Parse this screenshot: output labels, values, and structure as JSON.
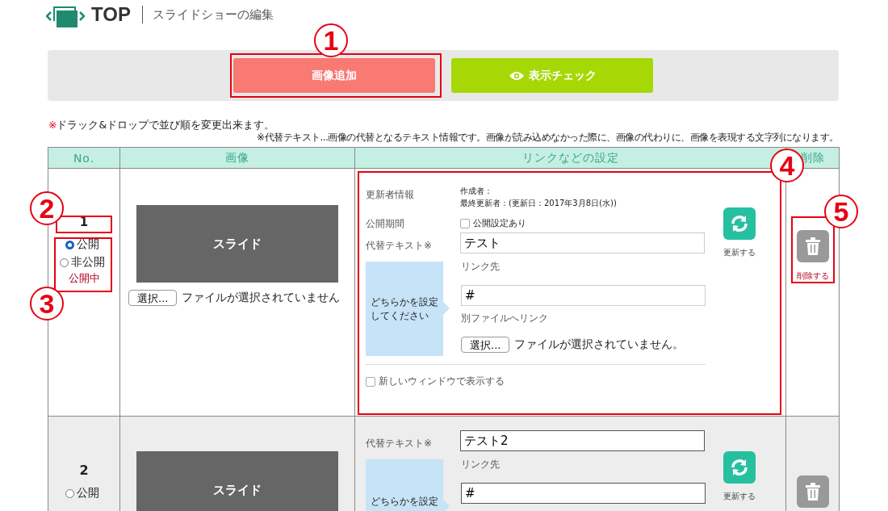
{
  "header": {
    "logo_text": "TOP",
    "subtitle": "スライドショーの編集"
  },
  "toolbar": {
    "add_button": "画像追加",
    "preview_button": "表示チェック"
  },
  "notes": {
    "mark": "※",
    "drag_note": "ドラック&ドロップで並び順を変更出来ます。",
    "alt_note": "※代替テキスト...画像の代替となるテキスト情報です。画像が読み込めなかった際に、画像の代わりに、画像を表現する文字列になります。"
  },
  "table": {
    "columns": [
      "No.",
      "画像",
      "リンクなどの設定",
      "削除"
    ],
    "rows": [
      {
        "no": "1",
        "visibility": [
          {
            "label": "公開",
            "selected": true
          },
          {
            "label": "非公開",
            "selected": false
          }
        ],
        "status": "公開中",
        "slide_label": "スライド",
        "file_button": "選択...",
        "file_status": "ファイルが選択されていません",
        "updater_label": "更新者情報",
        "creator": "作成者：",
        "last_updated": "最終更新者：(更新日：2017年3月8日(水))",
        "period_label": "公開期間",
        "period_checkbox": {
          "label": "公開設定あり",
          "checked": false
        },
        "alt_label": "代替テキスト※",
        "alt_value": "テスト",
        "callout_lines": [
          "どちらかを設定",
          "してください"
        ],
        "link_label": "リンク先",
        "link_value": "#",
        "file_link_label": "別ファイルへリンク",
        "file_link_button": "選択...",
        "file_link_status": "ファイルが選択されていません。",
        "new_window": {
          "label": "新しいウィンドウで表示する",
          "checked": false
        },
        "update_label": "更新する",
        "delete_label": "削除する"
      },
      {
        "no": "2",
        "visibility": [
          {
            "label": "公開",
            "selected": false
          }
        ],
        "slide_label": "スライド",
        "alt_label": "代替テキスト※",
        "alt_value": "テスト2",
        "callout_lines": [
          "どちらかを設定"
        ],
        "link_label": "リンク先",
        "link_value": "#",
        "update_label": "更新する"
      }
    ]
  },
  "annotations": [
    {
      "label": "1"
    },
    {
      "label": "2"
    },
    {
      "label": "3"
    },
    {
      "label": "4"
    },
    {
      "label": "5"
    }
  ]
}
